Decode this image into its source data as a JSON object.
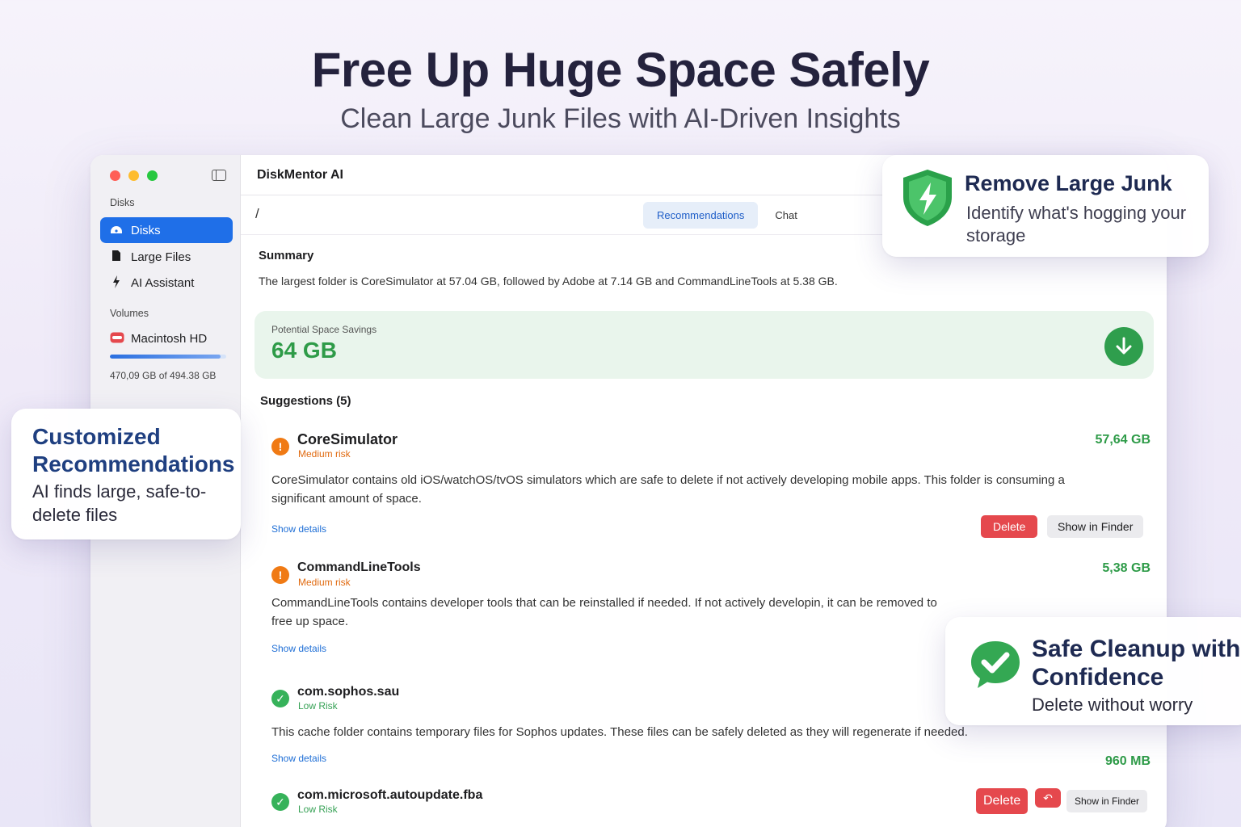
{
  "hero": {
    "title": "Free Up Huge Space Safely",
    "subtitle": "Clean Large Junk Files with AI-Driven Insights"
  },
  "sidebar": {
    "section_disks": "Disks",
    "items": [
      {
        "label": "Disks",
        "icon": "disk-icon",
        "active": true
      },
      {
        "label": "Large Files",
        "icon": "document-icon",
        "active": false
      },
      {
        "label": "AI Assistant",
        "icon": "sparkle-icon",
        "active": false
      }
    ],
    "section_volumes": "Volumes",
    "volume": {
      "name": "Macintosh HD",
      "usage": "470,09 GB of 494.38 GB",
      "used_fraction": 0.95
    }
  },
  "main": {
    "app_title": "DiskMentor AI",
    "path": "/",
    "tabs": [
      {
        "label": "Recommendations",
        "active": true
      },
      {
        "label": "Chat",
        "active": false
      }
    ],
    "summary_heading": "Summary",
    "summary_text": "The largest folder is CoreSimulator at 57.04 GB, followed by Adobe at 7.14 GB and CommandLineTools at 5.38 GB.",
    "savings_label": "Potential Space Savings",
    "savings_value": "64 GB",
    "suggestions_heading": "Suggestions (5)",
    "suggestions": [
      {
        "name": "CoreSimulator",
        "risk": "Medium risk",
        "size": "57,64 GB",
        "desc_line1": "CoreSimulator contains old iOS/watchOS/tvOS simulators which are safe to delete if not actively developing mobile apps. This folder is consuming a",
        "desc_line2": "significant amount of space.",
        "details": "Show details",
        "delete": "Delete",
        "finder": "Show in Finder"
      },
      {
        "name": "CommandLineTools",
        "risk": "Medium risk",
        "size": "5,38 GB",
        "desc_line1": "CommandLineTools contains developer tools that can be reinstalled if needed. If not actively developin, it can be removed to",
        "desc_line2": "free up space.",
        "details": "Show details"
      },
      {
        "name": "com.sophos.sau",
        "risk": "Low Risk",
        "size": "960 MB",
        "desc_line1": "This cache folder contains temporary files for Sophos updates. These files can be safely deleted as they will regenerate if needed.",
        "details": "Show details"
      },
      {
        "name": "com.microsoft.autoupdate.fba",
        "risk": "Low Risk",
        "delete": "Delete",
        "finder": "Show in Finder"
      }
    ]
  },
  "cards": {
    "junk": {
      "title": "Remove Large Junk",
      "subtitle": "Identify what's hogging your storage"
    },
    "reco": {
      "title": "Customized Recommendations",
      "subtitle": "AI finds large, safe-to-delete files"
    },
    "safe": {
      "title": "Safe Cleanup with Confidence",
      "subtitle": "Delete without worry"
    }
  },
  "colors": {
    "accent": "#1f6fe8",
    "savings_green": "#2e9b48",
    "medium_risk": "#f07a14",
    "low_risk": "#36b25a",
    "delete_red": "#e5484d"
  }
}
